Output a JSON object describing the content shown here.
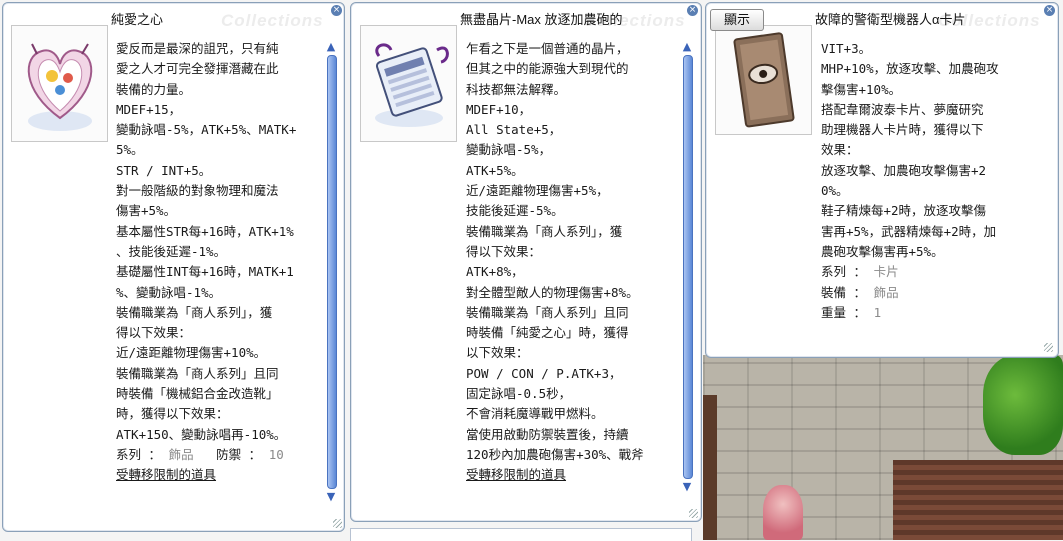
{
  "window1": {
    "title": "純愛之心",
    "watermark": "Collections",
    "lines": [
      "愛反而是最深的詛咒，只有純",
      "愛之人才可完全發揮潛藏在此",
      "裝備的力量。",
      "MDEF+15，",
      "變動詠唱-5%，ATK+5%、MATK+",
      "5%。",
      "STR / INT+5。",
      "對一般階級的對象物理和魔法",
      "傷害+5%。",
      "基本屬性STR每+16時，ATK+1%",
      "、技能後延遲-1%。",
      "基礎屬性INT每+16時，MATK+1",
      "%、變動詠唱-1%。",
      "裝備職業為「商人系列」，獲",
      "得以下效果：",
      "近/遠距離物理傷害+10%。",
      "裝備職業為「商人系列」且同",
      "時裝備「機械鋁合金改造靴」",
      "時，獲得以下效果：",
      "ATK+150、變動詠唱再-10%。"
    ],
    "type_label": "系列 ：",
    "type_value": "飾品",
    "def_label": "防禦 ：",
    "def_value": "10",
    "link": "受轉移限制的道具"
  },
  "window2": {
    "title": "無盡晶片-Max 放逐加農砲的",
    "watermark": "Collections",
    "lines": [
      "乍看之下是一個普通的晶片，",
      "但其之中的能源強大到現代的",
      "科技都無法解釋。",
      "MDEF+10，",
      "All State+5，",
      "變動詠唱-5%，",
      "ATK+5%。",
      "近/遠距離物理傷害+5%，",
      "技能後延遲-5%。",
      "裝備職業為「商人系列」，獲",
      "得以下效果：",
      "ATK+8%，",
      "對全體型敵人的物理傷害+8%。",
      "裝備職業為「商人系列」且同",
      "時裝備「純愛之心」時，獲得",
      "以下效果：",
      "POW / CON / P.ATK+3，",
      "固定詠唱-0.5秒，",
      "不會消耗魔導戰甲燃料。",
      "當使用啟動防禦裝置後，持續",
      "120秒內加農砲傷害+30%、戰斧"
    ],
    "link": "受轉移限制的道具"
  },
  "window3": {
    "show_button": "顯示",
    "title": "故障的警衛型機器人α卡片",
    "watermark": "Collections",
    "lines": [
      "VIT+3。",
      "MHP+10%，放逐攻擊、加農砲攻",
      "擊傷害+10%。",
      "搭配韋爾波泰卡片、夢魔研究",
      "助理機器人卡片時，獲得以下",
      "效果：",
      "放逐攻擊、加農砲攻擊傷害+2",
      "0%。",
      "鞋子精煉每+2時，放逐攻擊傷",
      "害再+5%，武器精煉每+2時，加",
      "農砲攻擊傷害再+5%。"
    ],
    "type_label": "系列 ：",
    "type_value": "卡片",
    "equip_label": "裝備 ：",
    "equip_value": "飾品",
    "weight_label": "重量 ：",
    "weight_value": "1"
  },
  "icons": {
    "close": "close-icon",
    "scroll_up": "scroll-up-arrow-icon",
    "scroll_down": "scroll-down-arrow-icon",
    "resize": "resize-grip-icon"
  },
  "colors": {
    "scrollbar": "#5b88d6",
    "window_border": "#8aa0b8"
  }
}
